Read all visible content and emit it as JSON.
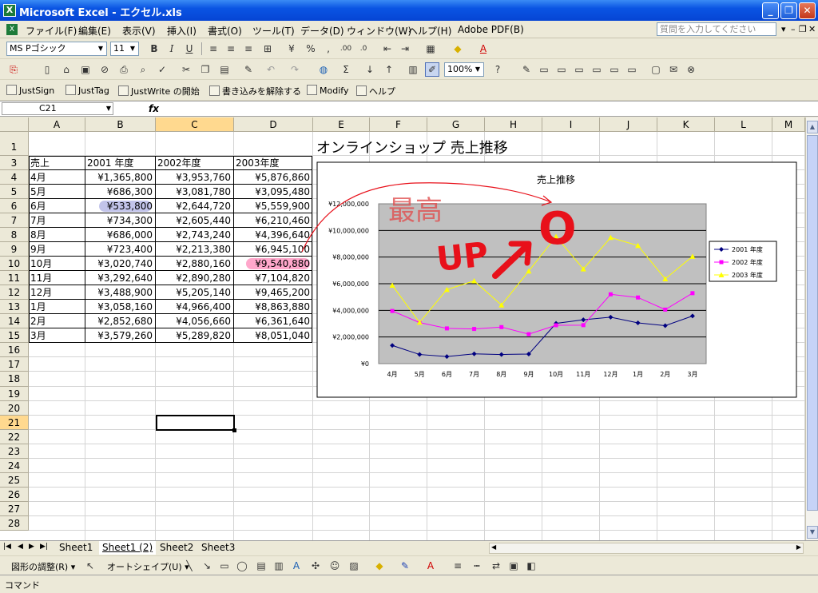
{
  "window": {
    "title": "Microsoft Excel - エクセル.xls",
    "app_icon": "X"
  },
  "menu": {
    "items": [
      "ファイル(F)",
      "編集(E)",
      "表示(V)",
      "挿入(I)",
      "書式(O)",
      "ツール(T)",
      "データ(D)",
      "ウィンドウ(W)",
      "ヘルプ(H)",
      "Adobe PDF(B)"
    ],
    "help_placeholder": "質問を入力してください"
  },
  "format_toolbar": {
    "font": "MS Pゴシック",
    "size": "11"
  },
  "standard_toolbar": {
    "zoom": "100%"
  },
  "justsystem_toolbar": {
    "items": [
      "JustSign",
      "JustTag",
      "JustWrite の開始",
      "書き込みを解除する",
      "Modify",
      "ヘルプ"
    ]
  },
  "formula_bar": {
    "cell_ref": "C21",
    "fx": "fx",
    "content": ""
  },
  "sheet": {
    "columns": [
      "A",
      "B",
      "C",
      "D",
      "E",
      "F",
      "G",
      "H",
      "I",
      "J",
      "K",
      "L",
      "M"
    ],
    "rows": [
      "1",
      "3",
      "4",
      "5",
      "6",
      "7",
      "8",
      "9",
      "10",
      "11",
      "12",
      "13",
      "14",
      "15",
      "16",
      "17",
      "18",
      "19",
      "20",
      "21",
      "22",
      "23",
      "24",
      "25",
      "26",
      "27",
      "28"
    ],
    "active_col": "C",
    "active_row": "21",
    "title": "オンラインショップ 売上推移",
    "table_header": [
      "売上",
      "2001 年度",
      "2002年度",
      "2003年度"
    ],
    "table_rows": [
      [
        "4月",
        "¥1,365,800",
        "¥3,953,760",
        "¥5,876,860"
      ],
      [
        "5月",
        "¥686,300",
        "¥3,081,780",
        "¥3,095,480"
      ],
      [
        "6月",
        "¥533,800",
        "¥2,644,720",
        "¥5,559,900"
      ],
      [
        "7月",
        "¥734,300",
        "¥2,605,440",
        "¥6,210,460"
      ],
      [
        "8月",
        "¥686,000",
        "¥2,743,240",
        "¥4,396,640"
      ],
      [
        "9月",
        "¥723,400",
        "¥2,213,380",
        "¥6,945,100"
      ],
      [
        "10月",
        "¥3,020,740",
        "¥2,880,160",
        "¥9,540,880"
      ],
      [
        "11月",
        "¥3,292,640",
        "¥2,890,280",
        "¥7,104,820"
      ],
      [
        "12月",
        "¥3,488,900",
        "¥5,205,140",
        "¥9,465,200"
      ],
      [
        "1月",
        "¥3,058,160",
        "¥4,966,400",
        "¥8,863,880"
      ],
      [
        "2月",
        "¥2,852,680",
        "¥4,056,660",
        "¥6,361,640"
      ],
      [
        "3月",
        "¥3,579,260",
        "¥5,289,820",
        "¥8,051,040"
      ]
    ]
  },
  "chart_data": {
    "type": "line",
    "title": "売上推移",
    "categories": [
      "4月",
      "5月",
      "6月",
      "7月",
      "8月",
      "9月",
      "10月",
      "11月",
      "12月",
      "1月",
      "2月",
      "3月"
    ],
    "series": [
      {
        "name": "2001 年度",
        "color": "#000080",
        "marker": "diamond",
        "values": [
          1365800,
          686300,
          533800,
          734300,
          686000,
          723400,
          3020740,
          3292640,
          3488900,
          3058160,
          2852680,
          3579260
        ]
      },
      {
        "name": "2002 年度",
        "color": "#ff00ff",
        "marker": "square",
        "values": [
          3953760,
          3081780,
          2644720,
          2605440,
          2743240,
          2213380,
          2880160,
          2890280,
          5205140,
          4966400,
          4056660,
          5289820
        ]
      },
      {
        "name": "2003 年度",
        "color": "#ffff00",
        "marker": "triangle",
        "values": [
          5876860,
          3095480,
          5559900,
          6210460,
          4396640,
          6945100,
          9540880,
          7104820,
          9465200,
          8863880,
          6361640,
          8051040
        ]
      }
    ],
    "ylim": [
      0,
      12000000
    ],
    "yticks": [
      "¥0",
      "¥2,000,000",
      "¥4,000,000",
      "¥6,000,000",
      "¥8,000,000",
      "¥10,000,000",
      "¥12,000,000"
    ],
    "plot_background": "#c0c0c0",
    "grid": true,
    "legend": "right"
  },
  "annotations": {
    "kanji": "最高",
    "up_text": "UP",
    "circle_mark": "O",
    "ink_color": "#e8101a"
  },
  "sheet_tabs": [
    "Sheet1",
    "Sheet1 (2)",
    "Sheet2",
    "Sheet3"
  ],
  "active_tab": "Sheet1 (2)",
  "drawing_toolbar": {
    "draw_label": "図形の調整(R)",
    "autoshape_label": "オートシェイプ(U)"
  },
  "status": "コマンド"
}
